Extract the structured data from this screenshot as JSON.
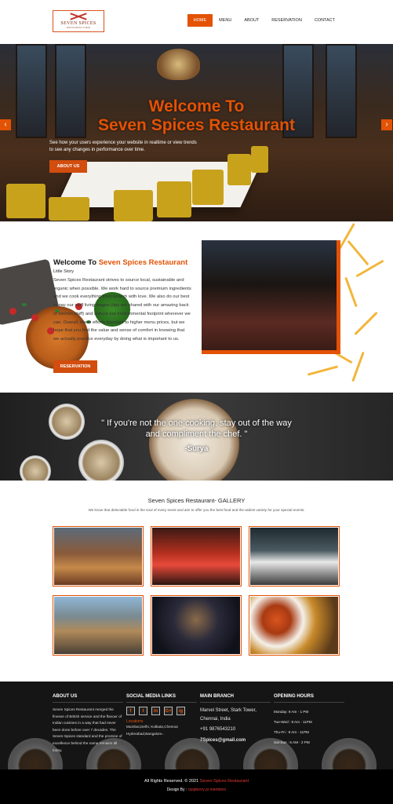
{
  "brand": {
    "name": "SEVEN SPICES",
    "tagline": "RESTAURANT & BAR"
  },
  "nav": {
    "items": [
      "HOME",
      "MENU",
      "ABOUT",
      "RESERVATION",
      "CONTACT"
    ],
    "active": "HOME"
  },
  "hero": {
    "title_line1": "Welcome To",
    "title_line2": "Seven Spices Restaurant",
    "subtitle": "See how your users experience your website in realtime or view trends to see any changes in performance over time.",
    "cta": "ABOUT US",
    "prev_icon": "chevron-left-icon",
    "next_icon": "chevron-right-icon"
  },
  "about": {
    "title_prefix": "Welcome To ",
    "title_highlight": "Seven Spices Restaurant",
    "kicker": "Little Story",
    "body": "Seven Spices Restaurant strives to source local, sustainable and organic when possible. We work hard to source premium ingredients and we cook everything from scratch with love. We also do our best to pay our staff living wages (tips are shared with our amazing back of kitchen staff) and reduce our environmental footprint wherever we can. Overall, these efforts translate to higher menu prices, but we hope that you find the value and sense of comfort in knowing that we actually practice everyday by doing what is important to us.",
    "cta": "RESERVATION"
  },
  "quote": {
    "text": "\" If you're not the one cooking, stay out of the way and compliment the chef. \"",
    "author": "-Surya"
  },
  "gallery": {
    "title": "Seven Spices Restaurant- GALLERY",
    "subtitle": "We know that delectable food is the soul of every event and aim to offer you the best food and the widest variety for your special events."
  },
  "footer": {
    "about_head": "ABOUT US",
    "about_text": "Seven Spices Restaurant merged the finesse of British service and the flavour of Indian cuisines in a way that had never been done before over 7 decades. The Seven-Spices standard and the promise of excellence behind the name remains till today.",
    "social_head": "SOCIAL MEDIA LINKS",
    "social_icons": [
      "f",
      "t",
      "in",
      "G+",
      "ig"
    ],
    "locations_label": "Locations",
    "locations": "Mumbai,Delhi, Kolkata,Chennai Hyderabad,Bangalore..",
    "branch_head": "MAIN BRANCH",
    "branch_address": "Marvel Street, Stark Tower, Chennai, India",
    "branch_phone": "+91 9876543210",
    "branch_email": "7Spices@gmail.com",
    "hours_head": "OPENING HOURS",
    "hours": [
      "Monday: 9 Am - 1 PM",
      "Tue-Wed : 9 Am - 11PM",
      "Thu-Fri : 9 Am - 11PM",
      "Sat-Sun : 6 AM - 2 PM"
    ]
  },
  "bottom": {
    "copy_prefix": "All Rights Reserved. © 2021 ",
    "copy_brand": "Seven-Spices Restaurant",
    "design_prefix": "Design By : ",
    "design_by": "raspberry pi members"
  },
  "colors": {
    "accent": "#e35205",
    "footer": "#151515",
    "quote_bg": "#2f2f2f"
  }
}
